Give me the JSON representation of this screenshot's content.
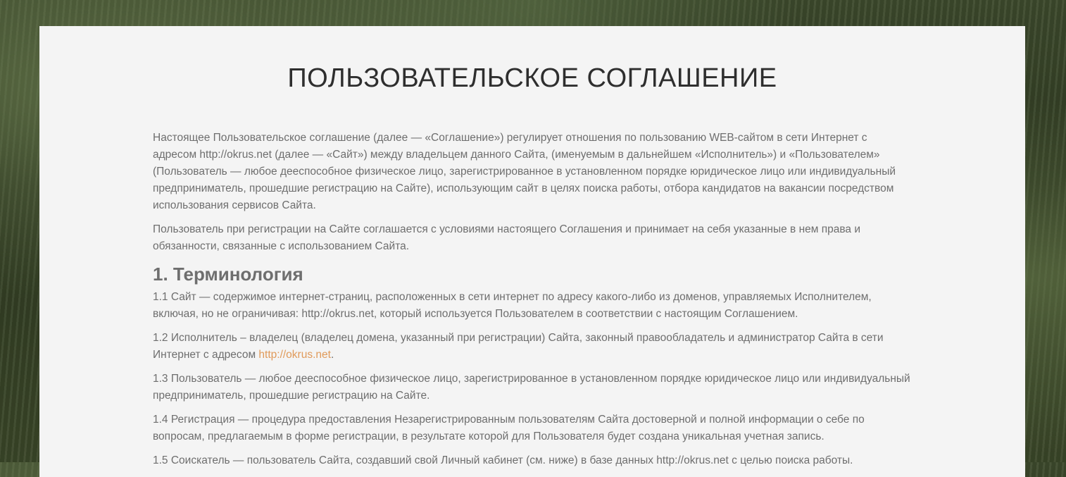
{
  "title": "ПОЛЬЗОВАТЕЛЬСКОЕ СОГЛАШЕНИЕ",
  "intro": [
    "Настоящее Пользовательское соглашение (далее — «Соглашение») регулирует отношения по пользованию WEB-сайтом в сети Интернет с адресом http://okrus.net (далее — «Сайт») между владельцем данного Сайта, (именуемым в дальнейшем «Исполнитель») и «Пользователем» (Пользователь — любое дееспособное физическое лицо, зарегистрированное в установленном порядке юридическое лицо или индивидуальный предприниматель, прошедшие регистрацию на Сайте), использующим сайт в целях поиска работы, отбора кандидатов на вакансии посредством использования сервисов Сайта.",
    "Пользователь при регистрации на Сайте соглашается с условиями настоящего Соглашения и принимает на себя указанные в нем права и обязанности, связанные с использованием Сайта."
  ],
  "section1": {
    "heading": "1. Терминология",
    "term_1_1": "1.1 Сайт — содержимое интернет-страниц, расположенных в сети интернет по адресу какого-либо из доменов, управляемых Исполнителем, включая, но не ограничивая: http://okrus.net, который используется Пользователем в соответствии с настоящим Соглашением.",
    "term_1_2": {
      "before": "1.2 Исполнитель – владелец (владелец домена, указанный при регистрации) Сайта, законный правообладатель и администратор Сайта в сети Интернет с адресом ",
      "link": "http://okrus.net",
      "after": "."
    },
    "term_1_3": "1.3 Пользователь — любое дееспособное физическое лицо, зарегистрированное в установленном порядке юридическое лицо или индивидуальный предприниматель, прошедшие регистрацию на Сайте.",
    "term_1_4": "1.4 Регистрация — процедура предоставления Незарегистрированным пользователям Сайта достоверной и полной информации о себе по вопросам, предлагаемым в форме регистрации, в результате которой для Пользователя будет создана уникальная учетная запись.",
    "term_1_5": "1.5 Соискатель — пользователь Сайта, создавший свой Личный кабинет (см. ниже) в базе данных http://okrus.net с целью поиска работы."
  },
  "colors": {
    "panel": "#f4f4f4",
    "text": "#6e6e6e",
    "title": "#2e2e2e",
    "link": "#e09a5a"
  }
}
